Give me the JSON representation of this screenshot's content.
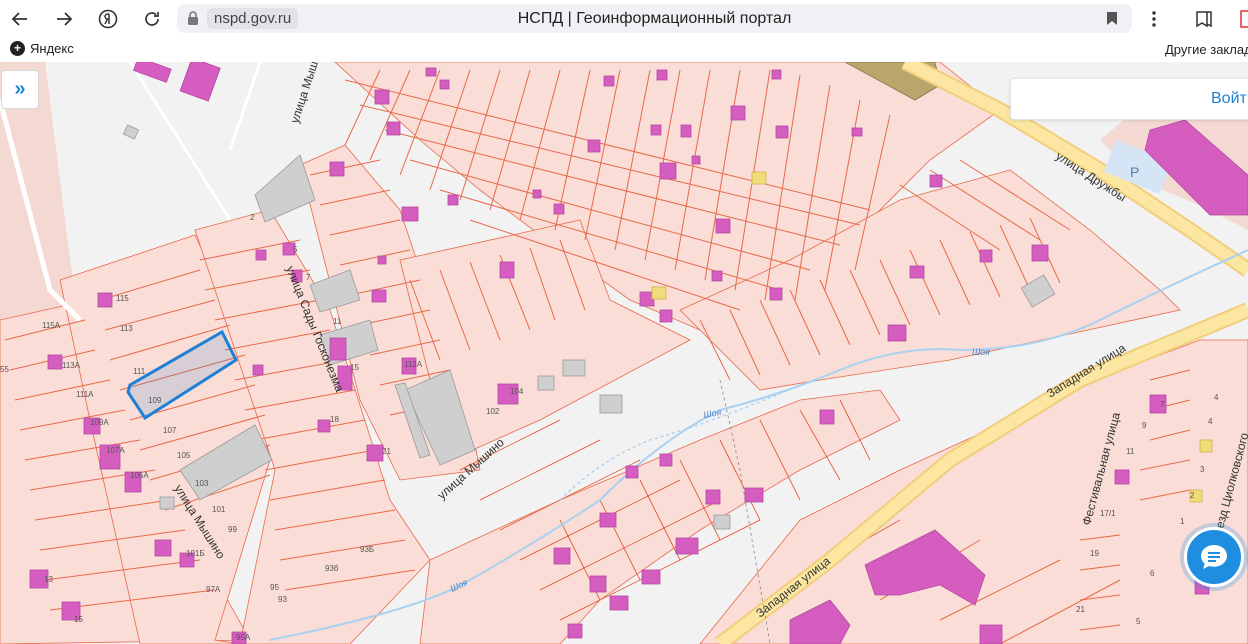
{
  "browser": {
    "url": "nspd.gov.ru",
    "title": "НСПД | Геоинформационный портал",
    "bookmarks": [
      {
        "label": "Яндекс",
        "icon": "yandex-icon"
      }
    ],
    "other_bookmarks": "Другие заклад"
  },
  "map": {
    "street_labels": [
      "улица Мышино",
      "улица Сады Госконезма",
      "улица Мышино",
      "улица Мышино",
      "улица Дружбы",
      "Западная улица",
      "Западная улица",
      "Фестивальная улица",
      "проезд Циолковского"
    ],
    "water_labels": [
      "Шоя",
      "Шоя",
      "Шоя"
    ],
    "parking_label": "P",
    "parcel_numbers": [
      "115",
      "115А",
      "113",
      "113А",
      "111",
      "111А",
      "109",
      "109А",
      "107",
      "107А",
      "105",
      "105А",
      "103",
      "101",
      "101Б",
      "99",
      "97А",
      "95",
      "93",
      "93Б",
      "93б",
      "95А",
      "2",
      "5",
      "7",
      "11",
      "18",
      "15",
      "21",
      "112А",
      "104",
      "102",
      "15",
      "55",
      "13",
      "9",
      "11",
      "17/1",
      "19",
      "21",
      "4",
      "6",
      "4",
      "3",
      "2",
      "1",
      "7",
      "5"
    ],
    "selected_parcel": "109"
  },
  "panel": {
    "expand_icon": "double-chevron-right-icon",
    "login_label": "Войт"
  },
  "chat": {
    "icon": "chat-icon"
  },
  "colors": {
    "parcel_fill": "#f9ddd6",
    "parcel_stroke": "#e8694a",
    "building": "#d55dc0",
    "road": "#fbe6a2",
    "selected": "#1e7fd6",
    "accent": "#1f8ee0"
  }
}
